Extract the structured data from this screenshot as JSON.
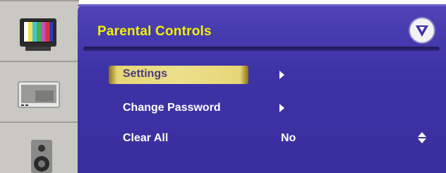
{
  "menu": {
    "title": "Parental Controls",
    "items": [
      {
        "label": "Settings"
      },
      {
        "label": "Change Password"
      },
      {
        "label": "Clear All",
        "value": "No"
      }
    ]
  },
  "rail_icons": [
    "tv-color-bars-icon",
    "monitor-icon",
    "speaker-icon"
  ],
  "colors": {
    "panel": "#3d33a6",
    "title": "#f4f000",
    "highlight": "#ece08a"
  }
}
